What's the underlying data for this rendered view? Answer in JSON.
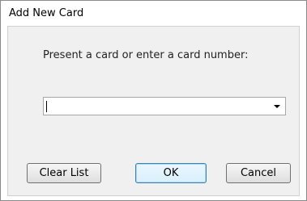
{
  "window": {
    "title": "Add New Card"
  },
  "dialog": {
    "prompt": "Present a card or enter a card number:",
    "card_input": {
      "value": "",
      "icon": "chevron-down-icon"
    },
    "buttons": {
      "clear_list": "Clear List",
      "ok": "OK",
      "cancel": "Cancel"
    }
  }
}
